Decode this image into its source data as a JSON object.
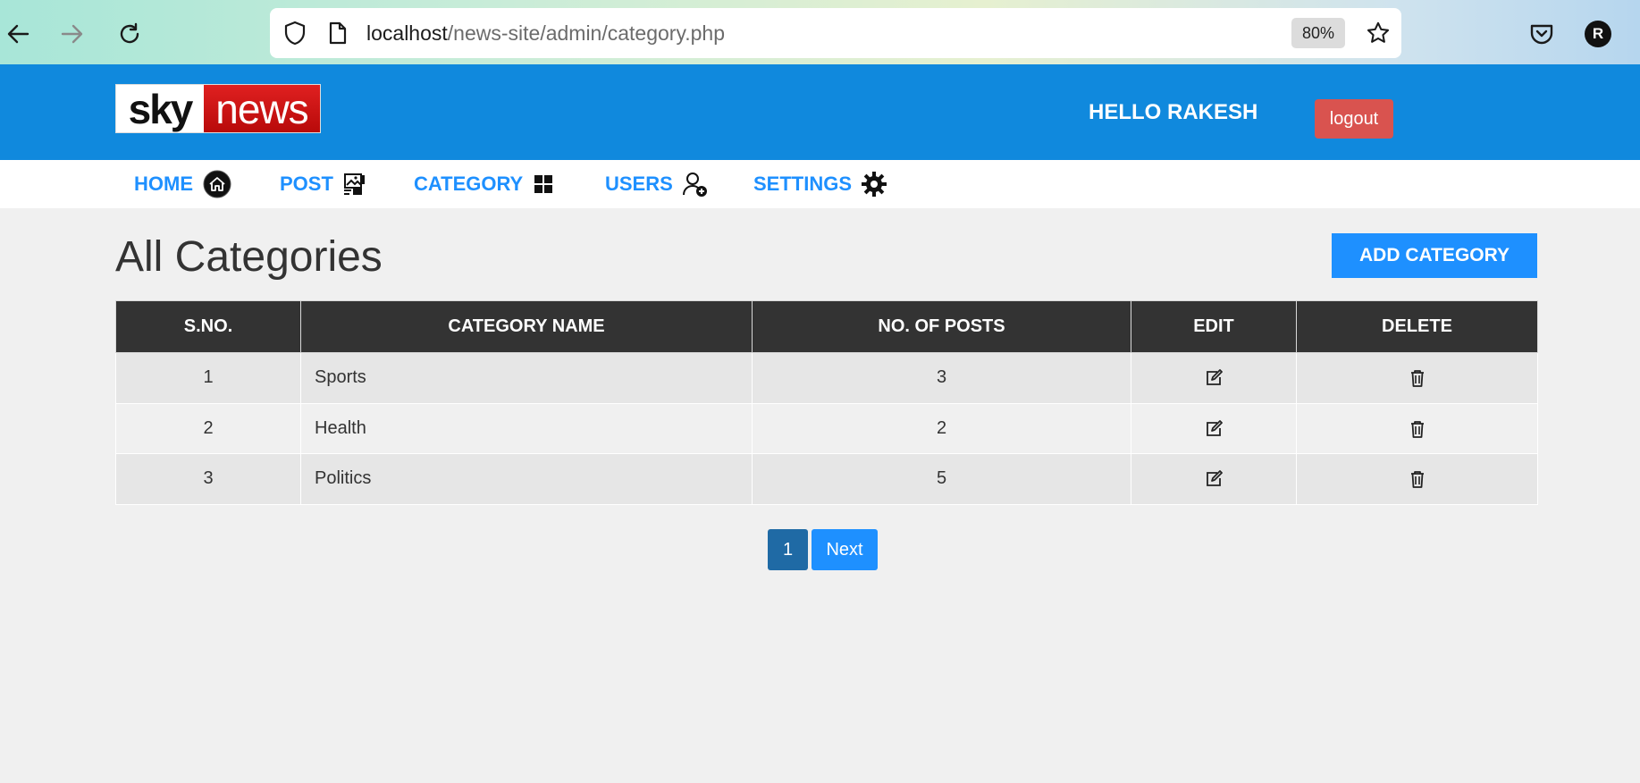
{
  "browser": {
    "url_host": "localhost",
    "url_path": "/news-site/admin/category.php",
    "zoom": "80%",
    "profile_initial": "R",
    "icons": [
      "back-arrow-icon",
      "forward-arrow-icon",
      "reload-icon",
      "shield-icon",
      "page-icon",
      "star-icon",
      "pocket-icon"
    ]
  },
  "header": {
    "logo_sky": "sky",
    "logo_news": "news",
    "greeting": "HELLO RAKESH",
    "logout_label": "logout",
    "colors": {
      "header_bg": "#1089dd",
      "logout_bg": "#d9534f",
      "logo_red": "#c8141c"
    }
  },
  "menu": {
    "items": [
      {
        "label": "HOME",
        "icon": "home-icon"
      },
      {
        "label": "POST",
        "icon": "post-image-icon"
      },
      {
        "label": "CATEGORY",
        "icon": "grid-icon"
      },
      {
        "label": "USERS",
        "icon": "add-user-icon"
      },
      {
        "label": "SETTINGS",
        "icon": "gear-icon"
      }
    ],
    "color": "#1e90ff"
  },
  "main": {
    "title": "All Categories",
    "add_button": "ADD CATEGORY",
    "table": {
      "headers": [
        "S.NO.",
        "CATEGORY NAME",
        "NO. OF POSTS",
        "EDIT",
        "DELETE"
      ],
      "rows": [
        {
          "sno": "1",
          "name": "Sports",
          "posts": "3"
        },
        {
          "sno": "2",
          "name": "Health",
          "posts": "2"
        },
        {
          "sno": "3",
          "name": "Politics",
          "posts": "5"
        }
      ],
      "edit_icon": "edit-icon",
      "delete_icon": "trash-icon"
    },
    "pagination": {
      "current": "1",
      "next": "Next"
    }
  }
}
